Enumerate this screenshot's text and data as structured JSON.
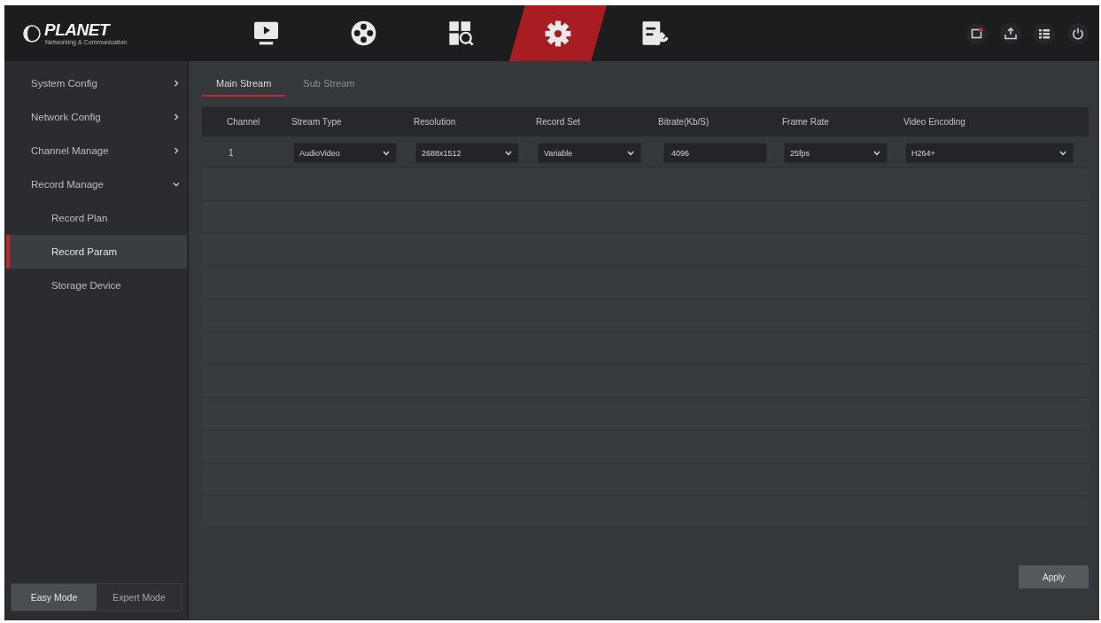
{
  "logo": {
    "name": "PLANET",
    "tagline": "Networking & Communication"
  },
  "nav": [
    {
      "selected": false
    },
    {
      "selected": false
    },
    {
      "selected": false
    },
    {
      "selected": true
    },
    {
      "selected": false
    }
  ],
  "sidebar": {
    "items": [
      {
        "label": "System Config",
        "selected": false,
        "expanded": false
      },
      {
        "label": "Network Config",
        "selected": false,
        "expanded": false
      },
      {
        "label": "Channel Manage",
        "selected": false,
        "expanded": false
      },
      {
        "label": "Record Manage",
        "selected": false,
        "expanded": true,
        "children": [
          {
            "label": "Record Plan",
            "selected": false
          },
          {
            "label": "Record Param",
            "selected": true
          },
          {
            "label": "Storage Device",
            "selected": false
          }
        ]
      }
    ]
  },
  "modes": [
    {
      "label": "Easy Mode",
      "selected": true
    },
    {
      "label": "Expert Mode",
      "selected": false
    }
  ],
  "tabs": [
    {
      "label": "Main Stream",
      "selected": true
    },
    {
      "label": "Sub Stream",
      "selected": false
    }
  ],
  "table": {
    "columns": [
      "Channel",
      "Stream Type",
      "Resolution",
      "Record Set",
      "Bitrate(Kb/S)",
      "Frame Rate",
      "Video Encoding"
    ],
    "rows": [
      {
        "cells": [
          {
            "kind": "text",
            "value": "1"
          },
          {
            "kind": "select",
            "value": "AudioVideo"
          },
          {
            "kind": "select",
            "value": "2688x1512"
          },
          {
            "kind": "select",
            "value": "Variable"
          },
          {
            "kind": "input",
            "value": "4096"
          },
          {
            "kind": "select",
            "value": "25fps"
          },
          {
            "kind": "select",
            "value": "H264+"
          }
        ]
      }
    ]
  },
  "apply_button": {
    "label": "Apply"
  }
}
